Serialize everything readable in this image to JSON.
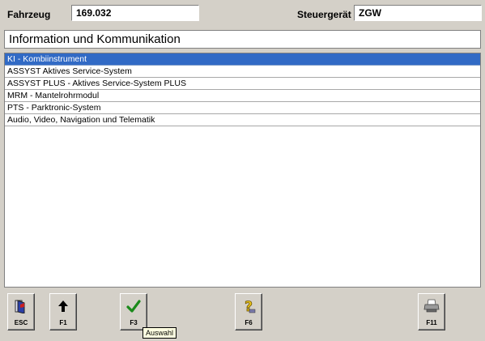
{
  "header": {
    "vehicle_label": "Fahrzeug",
    "vehicle_value": "169.032",
    "ecu_label": "Steuergerät",
    "ecu_value": "ZGW"
  },
  "section_title": "Information und Kommunikation",
  "list": {
    "items": [
      {
        "label": "KI - Kombiinstrument",
        "selected": true
      },
      {
        "label": "ASSYST Aktives Service-System",
        "selected": false
      },
      {
        "label": "ASSYST PLUS - Aktives Service-System PLUS",
        "selected": false
      },
      {
        "label": "MRM - Mantelrohrmodul",
        "selected": false
      },
      {
        "label": "PTS - Parktronic-System",
        "selected": false
      },
      {
        "label": "Audio, Video, Navigation und Telematik",
        "selected": false
      }
    ]
  },
  "function_keys": [
    {
      "label": "ESC",
      "icon": "exit-door-icon"
    },
    {
      "label": "F1",
      "icon": "arrow-up-icon"
    },
    {
      "label": "F3",
      "icon": "checkmark-icon"
    },
    {
      "label": "F6",
      "icon": "help-question-icon"
    },
    {
      "label": "F11",
      "icon": "printer-icon"
    }
  ],
  "tooltip": "Auswahl",
  "colors": {
    "background": "#d4d0c8",
    "selection": "#316ac5",
    "check_green": "#1a8a1a",
    "help_yellow": "#e8c21a"
  }
}
